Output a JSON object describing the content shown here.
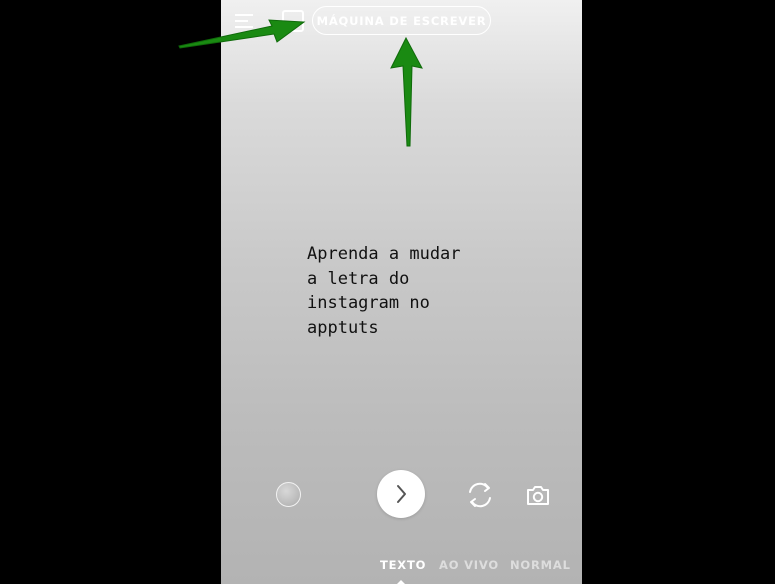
{
  "toolbar": {
    "menu_icon": "align-lines-icon",
    "text_align_icon": "text-background-icon",
    "font_name": "MÁQUINA DE ESCREVER"
  },
  "story": {
    "text": "Aprenda a mudar\na letra do\ninstagram no\napptuts"
  },
  "controls": {
    "gallery_icon": "color-circle-icon",
    "next_icon": "chevron-right-icon",
    "flip_icon": "camera-flip-icon",
    "camera_icon": "camera-icon"
  },
  "modes": {
    "items": [
      "TEXTO",
      "AO VIVO",
      "NORMAL"
    ],
    "selected": "TEXTO"
  },
  "annotations": {
    "arrow_color": "#1a8a12"
  },
  "colors": {
    "background": "#000000",
    "canvas_top": "#f0f0f0",
    "canvas_bottom": "#b3b3b3",
    "text": "#111111",
    "ui_white": "#ffffff"
  }
}
